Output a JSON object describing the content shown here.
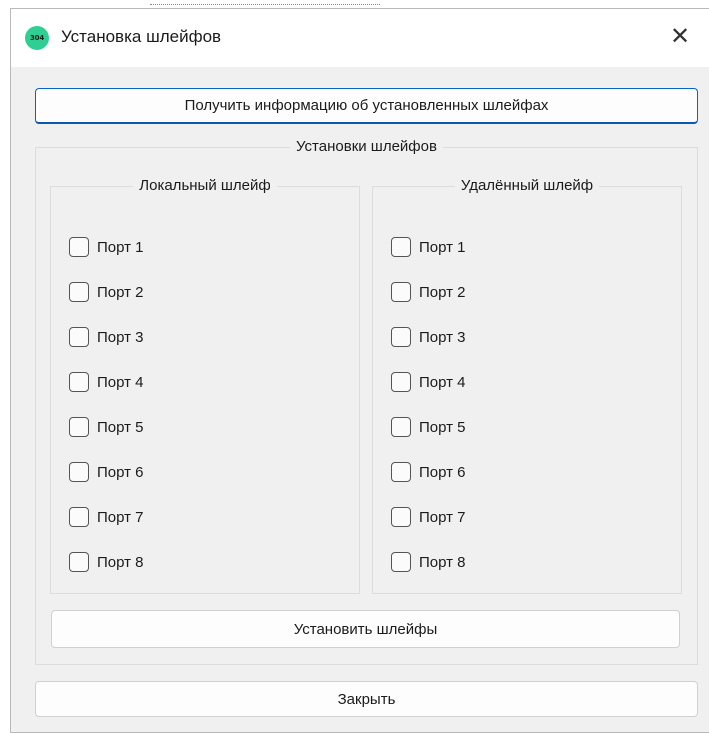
{
  "window": {
    "title": "Установка шлейфов",
    "icon_text": "304",
    "close_glyph": "✕"
  },
  "buttons": {
    "get_info": "Получить информацию об установленных шлейфах",
    "install": "Установить шлейфы",
    "close": "Закрыть"
  },
  "groups": {
    "outer_title": "Установки шлейфов",
    "local": {
      "title": "Локальный шлейф",
      "ports": [
        {
          "label": "Порт 1",
          "checked": false
        },
        {
          "label": "Порт 2",
          "checked": false
        },
        {
          "label": "Порт 3",
          "checked": false
        },
        {
          "label": "Порт 4",
          "checked": false
        },
        {
          "label": "Порт 5",
          "checked": false
        },
        {
          "label": "Порт 6",
          "checked": false
        },
        {
          "label": "Порт 7",
          "checked": false
        },
        {
          "label": "Порт 8",
          "checked": false
        }
      ]
    },
    "remote": {
      "title": "Удалённый шлейф",
      "ports": [
        {
          "label": "Порт 1",
          "checked": false
        },
        {
          "label": "Порт 2",
          "checked": false
        },
        {
          "label": "Порт 3",
          "checked": false
        },
        {
          "label": "Порт 4",
          "checked": false
        },
        {
          "label": "Порт 5",
          "checked": false
        },
        {
          "label": "Порт 6",
          "checked": false
        },
        {
          "label": "Порт 7",
          "checked": false
        },
        {
          "label": "Порт 8",
          "checked": false
        }
      ]
    }
  },
  "colors": {
    "accent_border": "#0a64c8",
    "app_icon": "#2fcf93",
    "dialog_bg": "#f0f0f0"
  }
}
